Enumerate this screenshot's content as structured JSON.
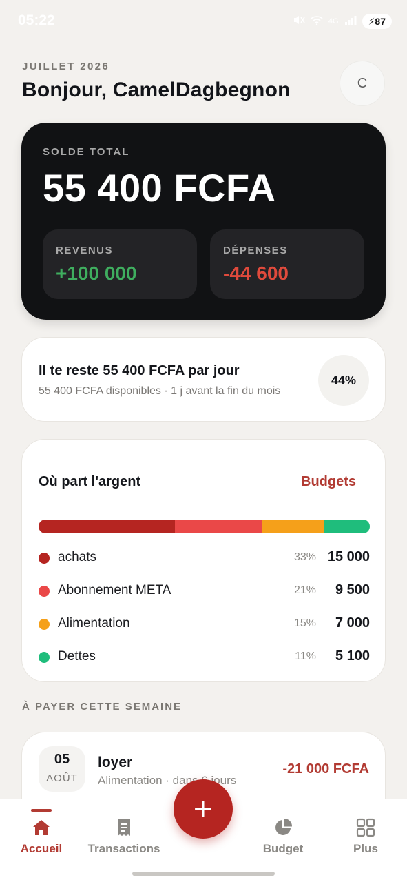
{
  "status_bar": {
    "time": "05:22",
    "network": "4G",
    "battery": "87"
  },
  "header": {
    "month": "JUILLET 2026",
    "greeting": "Bonjour, CamelDagbegnon",
    "avatar_initial": "C"
  },
  "balance": {
    "label": "SOLDE TOTAL",
    "value": "55 400 FCFA",
    "income_label": "REVENUS",
    "income_value": "+100 000",
    "expense_label": "DÉPENSES",
    "expense_value": "-44 600",
    "income_color": "#3fae5f",
    "expense_color": "#e04a3c"
  },
  "remaining": {
    "title": "Il te reste 55 400 FCFA par jour",
    "subtitle": "55 400 FCFA disponibles · 1 j avant la fin du mois",
    "percent": "44%"
  },
  "spending": {
    "title": "Où part l'argent",
    "link": "Budgets",
    "categories": [
      {
        "name": "achats",
        "percent": "33%",
        "amount": "15 000",
        "color": "#b52521",
        "share": 33
      },
      {
        "name": "Abonnement META",
        "percent": "21%",
        "amount": "9 500",
        "color": "#ea4848",
        "share": 21
      },
      {
        "name": "Alimentation",
        "percent": "15%",
        "amount": "7 000",
        "color": "#f5a01a",
        "share": 15
      },
      {
        "name": "Dettes",
        "percent": "11%",
        "amount": "5 100",
        "color": "#1fbd7c",
        "share": 11
      }
    ]
  },
  "upcoming": {
    "title": "À PAYER CETTE SEMAINE",
    "items": [
      {
        "day": "05",
        "month": "AOÛT",
        "name": "loyer",
        "detail": "Alimentation · dans 6 jours",
        "amount": "-21 000 FCFA"
      }
    ]
  },
  "nav": {
    "items": [
      {
        "label": "Accueil",
        "icon": "home-icon",
        "active": true
      },
      {
        "label": "Transactions",
        "icon": "receipt-icon",
        "active": false
      },
      {
        "label": "Budget",
        "icon": "pie-chart-icon",
        "active": false
      },
      {
        "label": "Plus",
        "icon": "grid-icon",
        "active": false
      }
    ],
    "accent": "#b23b33"
  }
}
